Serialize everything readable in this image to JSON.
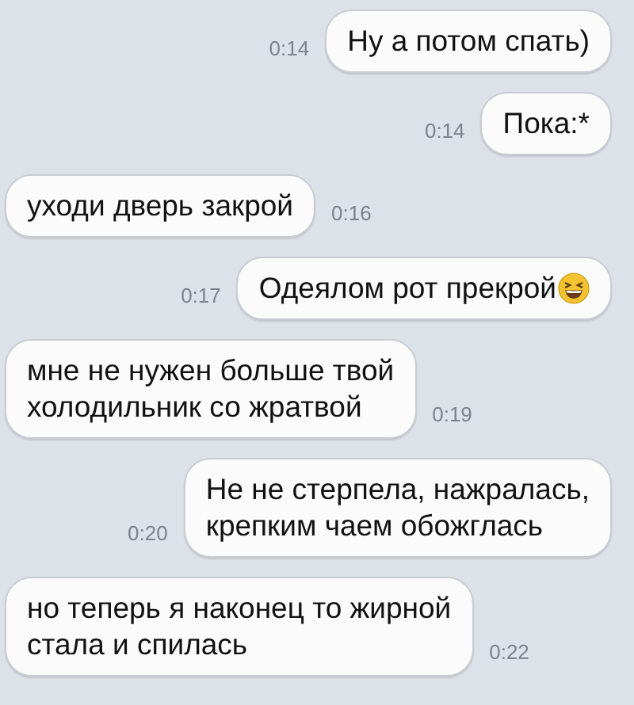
{
  "messages": [
    {
      "kind": "out",
      "text": "Ну а потом спать)",
      "time": "0:14"
    },
    {
      "kind": "out",
      "text": "Пока:*",
      "time": "0:14"
    },
    {
      "kind": "in",
      "text": "уходи дверь закрой",
      "time": "0:16"
    },
    {
      "kind": "out",
      "text": "Одеялом рот прекрой",
      "time": "0:17",
      "emoji": true
    },
    {
      "kind": "in",
      "text": "мне не нужен больше твой\nхолодильник со жратвой",
      "time": "0:19"
    },
    {
      "kind": "out",
      "text": "Не не стерпела, нажралась,\nкрепким чаем обожглась",
      "time": "0:20"
    },
    {
      "kind": "in",
      "text": "но теперь я наконец то жирной\nстала и спилась",
      "time": "0:22"
    }
  ]
}
